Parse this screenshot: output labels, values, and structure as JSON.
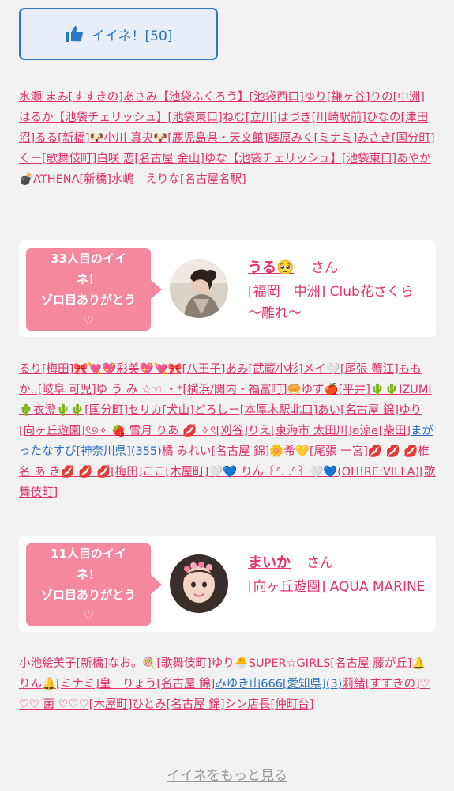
{
  "like_button": {
    "icon": "thumbs-up-icon",
    "label": "イイネ！[50]"
  },
  "names_block_1": [
    {
      "t": "水瀬 まみ[すすきの]"
    },
    {
      "t": "あさみ【池袋ふくろう】[池袋西口]"
    },
    {
      "t": "ゆり[鎌ヶ谷]"
    },
    {
      "t": "りの[中洲]"
    },
    {
      "t": "はるか【池袋チェリッシュ】[池袋東口]"
    },
    {
      "t": "ねむ[立川]"
    },
    {
      "t": "はづき[川崎駅前]"
    },
    {
      "t": "ひなの[津田沼]"
    },
    {
      "t": "るる[新橋]"
    },
    {
      "t": "🐶小川 真央🐶[鹿児島県・天文館]"
    },
    {
      "t": "藤原みく[ミナミ]"
    },
    {
      "t": "みさき[国分町]"
    },
    {
      "t": "くー[歌舞伎町]"
    },
    {
      "t": "白咲 恋[名古屋 金山]"
    },
    {
      "t": "ゆな【池袋チェリッシュ】[池袋東口]"
    },
    {
      "t": "あやか💣ATHENA[新橋]"
    },
    {
      "t": "水嶋　えりな[名古屋名駅]"
    }
  ],
  "card_1": {
    "bubble": [
      "33人目のイイ",
      "ネ！",
      "ゾロ目ありがとう",
      "♡"
    ],
    "name": "うる🥺",
    "san": "さん",
    "shop": "[福岡　中洲] Club花さくら～離れ～"
  },
  "names_block_2": [
    {
      "t": "るり[梅田]"
    },
    {
      "t": "🎀💘💖彩美💖💘🎀[八王子]"
    },
    {
      "t": "あみ[武蔵小杉]"
    },
    {
      "t": "メイ🤍[尾張 蟹江]"
    },
    {
      "t": "ももか..[岐阜 可児]"
    },
    {
      "t": "ゆ う み ☆☜ ・*[横浜/関内・福富町]"
    },
    {
      "t": "🥯ゆず🍎[平井]"
    },
    {
      "t": "🌵🌵IZUMI🌵衣澄🌵🌵[国分町]"
    },
    {
      "t": "セリカ[犬山]"
    },
    {
      "t": "どろしー[本厚木駅北口]"
    },
    {
      "t": "あい[名古屋 錦]"
    },
    {
      "t": "ゆり[向ヶ丘遊園]"
    },
    {
      "t": "ৎ୭✧ 🍓 雪月 りあ 💋 ✧ৎ[刈谷]"
    },
    {
      "t": "りえ[東海市 太田川]"
    },
    {
      "t": "ʚ涼ɞ[柴田]"
    },
    {
      "t": "まがったなすび[神奈川県](355)",
      "c": "blue"
    },
    {
      "t": "橘 みれい[名古屋 錦]"
    },
    {
      "t": "🌼希💛[尾張 一宮]"
    },
    {
      "t": "💋 💋 💋椎 名 あ き💋 💋 💋[梅田]"
    },
    {
      "t": "ここ[木屋町]"
    },
    {
      "t": "🤍💙 りん ꒰ᐢ. .ᐢ꒱ 🤍💙(OH!RE:VILLA)[歌舞伎町]"
    }
  ],
  "card_2": {
    "bubble": [
      "11人目のイイ",
      "ネ！",
      "ゾロ目ありがとう",
      "♡"
    ],
    "name": "まいか",
    "san": "さん",
    "shop": "[向ヶ丘遊園] AQUA MARINE"
  },
  "names_block_3": [
    {
      "t": "小池絵美子[新橋]"
    },
    {
      "t": "なお。🍭[歌舞伎町]"
    },
    {
      "t": "ゆり🐣SUPER☆GIRLS[名古屋 藤が丘]"
    },
    {
      "t": "🔔りん🔔[ミナミ]"
    },
    {
      "t": "皇　りょう[名古屋 錦]"
    },
    {
      "t": "みゆき山666[愛知県](3)",
      "c": "blue"
    },
    {
      "t": "莉緒[すすきの]"
    },
    {
      "t": "♡♡♡ 菌 ♡♡♡[木屋町]"
    },
    {
      "t": "ひとみ[名古屋 錦]"
    },
    {
      "t": "シン店長[仲町台]"
    }
  ],
  "more_link": "イイネをもっと見る",
  "colors": {
    "accent_pink": "#e0336e",
    "bubble_pink": "#f4889e",
    "button_blue": "#2a78c5",
    "link_blue": "#2a6fbf"
  }
}
